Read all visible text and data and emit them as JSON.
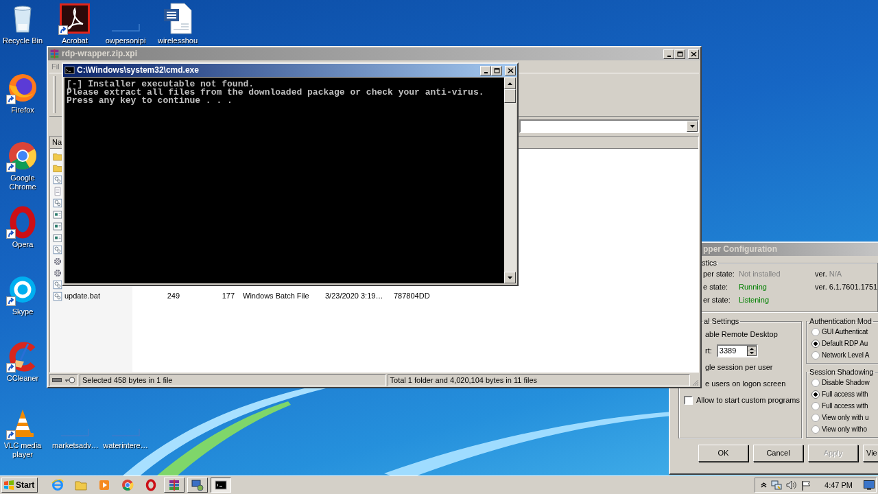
{
  "desktop_icons": [
    {
      "kind": "recycle-bin",
      "label": "Recycle Bin",
      "shortcut": false
    },
    {
      "kind": "pdf",
      "label": "Acrobat",
      "shortcut": true
    },
    {
      "kind": "thumbnail",
      "label": "owpersonipi",
      "shortcut": false
    },
    {
      "kind": "document",
      "label": "wirelesshou",
      "shortcut": false
    },
    {
      "kind": "firefox",
      "label": "Firefox",
      "shortcut": true
    },
    {
      "kind": "chrome",
      "label": "Google Chrome",
      "shortcut": true
    },
    {
      "kind": "opera",
      "label": "Opera",
      "shortcut": true
    },
    {
      "kind": "skype",
      "label": "Skype",
      "shortcut": true
    },
    {
      "kind": "ccleaner",
      "label": "CCleaner",
      "shortcut": true
    },
    {
      "kind": "vlc",
      "label": "VLC media player",
      "shortcut": true
    },
    {
      "kind": "thumbnail",
      "label": "marketsadv…",
      "shortcut": false
    },
    {
      "kind": "thumbnail",
      "label": "waterintere…",
      "shortcut": false
    }
  ],
  "archive_window": {
    "title": "rdp-wrapper.zip.xpi",
    "menu": [
      "Fil"
    ],
    "columns": [
      "Na"
    ],
    "rows": [
      {
        "kind": "folder"
      },
      {
        "kind": "folder"
      },
      {
        "kind": "batch"
      },
      {
        "kind": "text"
      },
      {
        "kind": "batch"
      },
      {
        "kind": "window"
      },
      {
        "kind": "window"
      },
      {
        "kind": "window"
      },
      {
        "kind": "batch"
      },
      {
        "kind": "gear"
      },
      {
        "kind": "gear"
      },
      {
        "kind": "batch"
      },
      {
        "kind": "batch",
        "cells": [
          "update.bat",
          "249",
          "177",
          "Windows Batch File",
          "3/23/2020 3:19…",
          "787804DD"
        ]
      }
    ],
    "status": [
      "Selected 458 bytes in 1 file",
      "Total 1 folder and 4,020,104 bytes in 11 files"
    ]
  },
  "console_window": {
    "title": "C:\\Windows\\system32\\cmd.exe",
    "lines": [
      "[-] Installer executable not found.",
      "Please extract all files from the downloaded package or check your anti-virus.",
      "Press any key to continue . . ."
    ]
  },
  "config_window": {
    "title": "pper Configuration",
    "diagnostics": {
      "legend": "stics",
      "rows": [
        {
          "label": "per state:",
          "value": "Not installed",
          "color": "#808080",
          "version_prefix": "ver.",
          "version": "N/A",
          "version_muted": true
        },
        {
          "label": "e state:",
          "value": "Running",
          "color": "#008000",
          "version_prefix": "ver.",
          "version": "6.1.7601.1751",
          "version_muted": false
        },
        {
          "label": "er state:",
          "value": "Listening",
          "color": "#008000"
        }
      ]
    },
    "general": {
      "legend": "al Settings",
      "items": [
        {
          "kind": "partial",
          "label": "able Remote Desktop"
        },
        {
          "kind": "port",
          "label": "rt:",
          "value": "3389"
        },
        {
          "kind": "partial",
          "label": "gle session per user"
        },
        {
          "kind": "partial",
          "label": "e users on logon screen"
        },
        {
          "kind": "checkbox",
          "label": "Allow to start custom programs",
          "checked": false
        }
      ]
    },
    "authentication": {
      "legend": "Authentication Mod",
      "options": [
        {
          "label": "GUI Authenticat",
          "selected": false
        },
        {
          "label": "Default RDP Au",
          "selected": true
        },
        {
          "label": "Network Level A",
          "selected": false
        }
      ]
    },
    "shadowing": {
      "legend": "Session Shadowing",
      "options": [
        {
          "label": "Disable Shadow",
          "selected": false
        },
        {
          "label": "Full access with",
          "selected": true
        },
        {
          "label": "Full access with",
          "selected": false
        },
        {
          "label": "View only with u",
          "selected": false
        },
        {
          "label": "View only witho",
          "selected": false
        }
      ]
    },
    "buttons": [
      {
        "label": "OK",
        "disabled": false
      },
      {
        "label": "Cancel",
        "disabled": false
      },
      {
        "label": "Apply",
        "disabled": true
      },
      {
        "label": "Vie",
        "disabled": false
      }
    ]
  },
  "taskbar": {
    "start": "Start",
    "buttons": [
      {
        "kind": "browser",
        "task": false
      },
      {
        "kind": "folder",
        "task": false
      },
      {
        "kind": "media",
        "task": false
      },
      {
        "kind": "chrome",
        "task": false
      },
      {
        "kind": "opera",
        "task": false
      },
      {
        "kind": "archive",
        "task": true,
        "active": false
      },
      {
        "kind": "monitor",
        "task": true,
        "active": false
      },
      {
        "kind": "terminal",
        "task": true,
        "active": true
      }
    ],
    "clock": "4:47 PM"
  }
}
